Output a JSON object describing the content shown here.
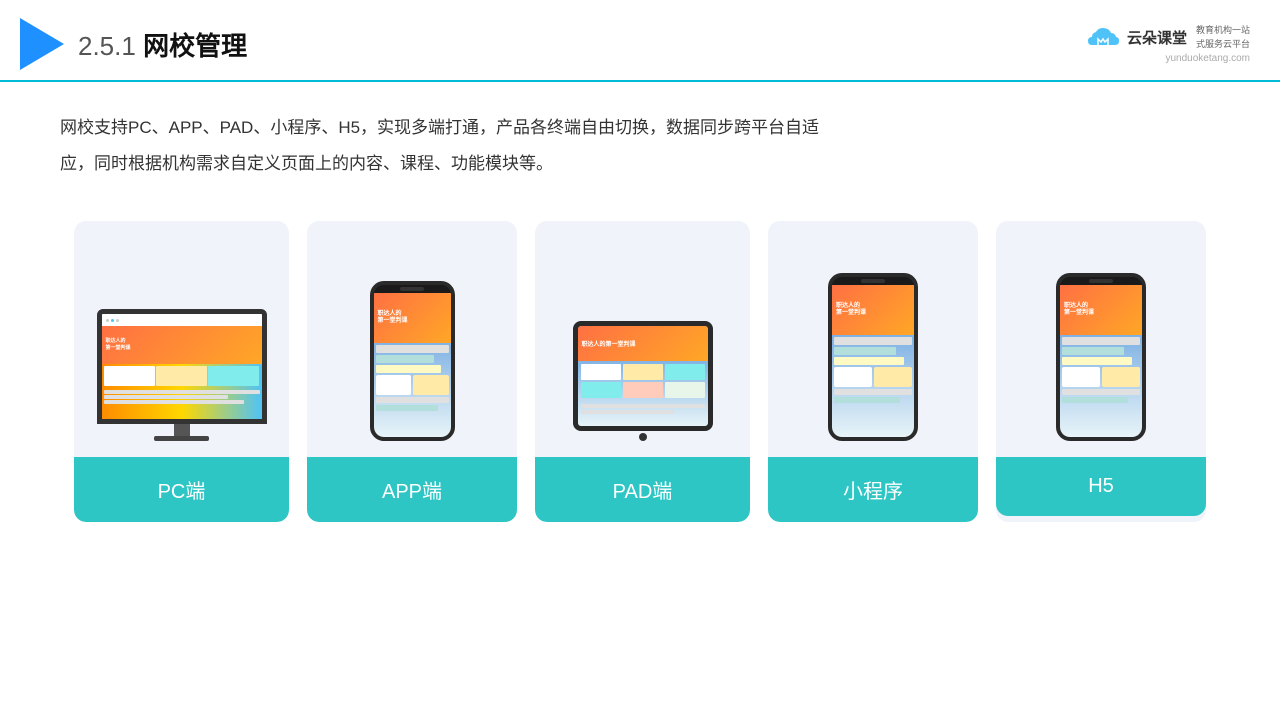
{
  "header": {
    "logo_alt": "play button triangle",
    "title_prefix": "2.5.1",
    "title_main": "网校管理",
    "brand_name": "云朵课堂",
    "brand_url": "yunduoketang.com",
    "brand_tagline_line1": "教育机构一站",
    "brand_tagline_line2": "式服务云平台"
  },
  "description": {
    "text": "网校支持PC、APP、PAD、小程序、H5，实现多端打通，产品各终端自由切换，数据同步跨平台自适应，同时根据机构需求自定义页面上的内容、课程、功能模块等。"
  },
  "cards": [
    {
      "id": "pc",
      "label": "PC端",
      "device_type": "monitor"
    },
    {
      "id": "app",
      "label": "APP端",
      "device_type": "phone"
    },
    {
      "id": "pad",
      "label": "PAD端",
      "device_type": "tablet"
    },
    {
      "id": "miniapp",
      "label": "小程序",
      "device_type": "phone"
    },
    {
      "id": "h5",
      "label": "H5",
      "device_type": "phone"
    }
  ],
  "colors": {
    "accent": "#2ec5c5",
    "header_line": "#00bcd4",
    "card_bg": "#f0f4fa",
    "title_color": "#111"
  }
}
